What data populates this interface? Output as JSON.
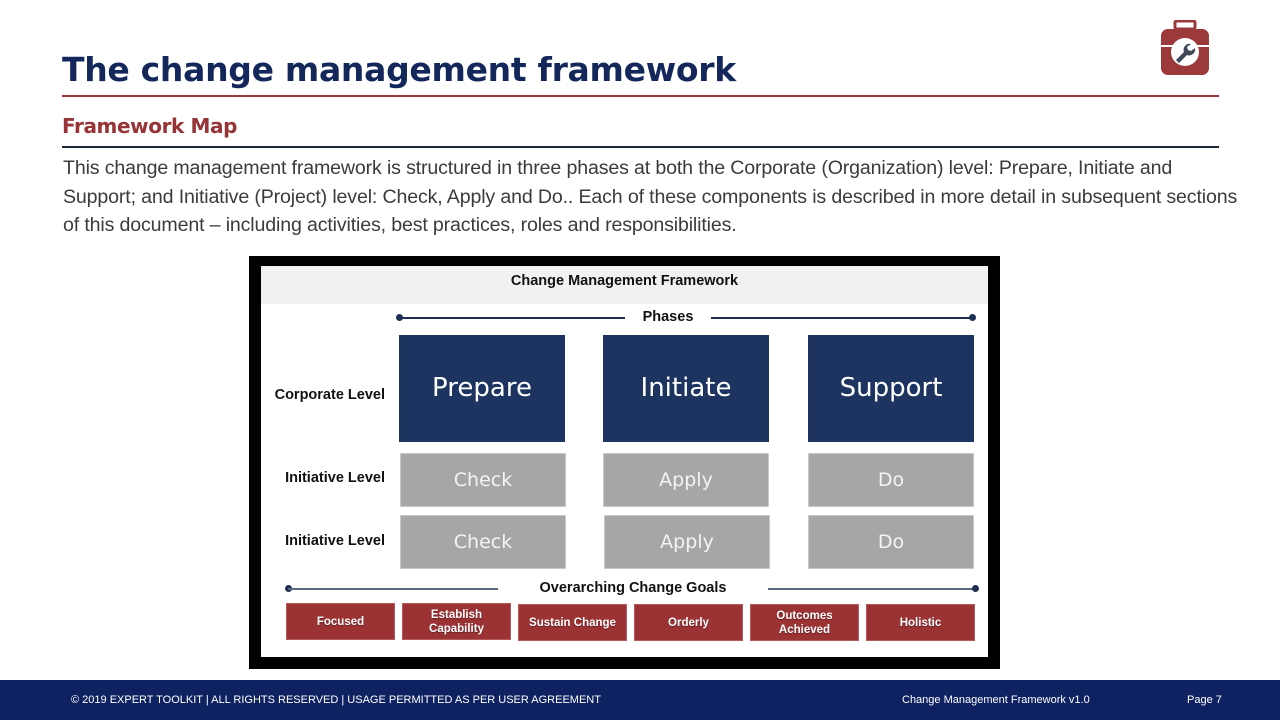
{
  "header": {
    "title": "The change management framework",
    "subtitle": "Framework Map",
    "logo_icon": "toolkit-wrench-icon",
    "accent_red": "#9c3a3b",
    "brand_navy": "#13275a"
  },
  "intro": {
    "text": "This change management framework is structured in three phases at both the Corporate (Organization) level: Prepare, Initiate and Support; and Initiative (Project) level: Check, Apply and Do.. Each of these components is described in more detail in subsequent sections of this document – including activities, best practices, roles and responsibilities."
  },
  "framework": {
    "title": "Change Management Framework",
    "phases_label": "Phases",
    "rows": [
      {
        "label": "Corporate Level",
        "cells": [
          "Prepare",
          "Initiate",
          "Support"
        ]
      },
      {
        "label": "Initiative  Level",
        "cells": [
          "Check",
          "Apply",
          "Do"
        ]
      },
      {
        "label": "Initiative Level",
        "cells": [
          "Check",
          "Apply",
          "Do"
        ]
      }
    ],
    "goals_label": "Overarching Change Goals",
    "goals": [
      "Focused",
      "Establish Capability",
      "Sustain Change",
      "Orderly",
      "Outcomes Achieved",
      "Holistic"
    ],
    "colors": {
      "phase_box": "#1d3461",
      "initiative_box": "#a6a6a6",
      "goal_box": "#9b3234"
    }
  },
  "footer": {
    "copyright": "© 2019 EXPERT TOOLKIT | ALL RIGHTS RESERVED | USAGE PERMITTED AS PER USER AGREEMENT",
    "doc_name": "Change Management Framework v1.0",
    "page": "Page 7",
    "background": "#0e2261"
  }
}
